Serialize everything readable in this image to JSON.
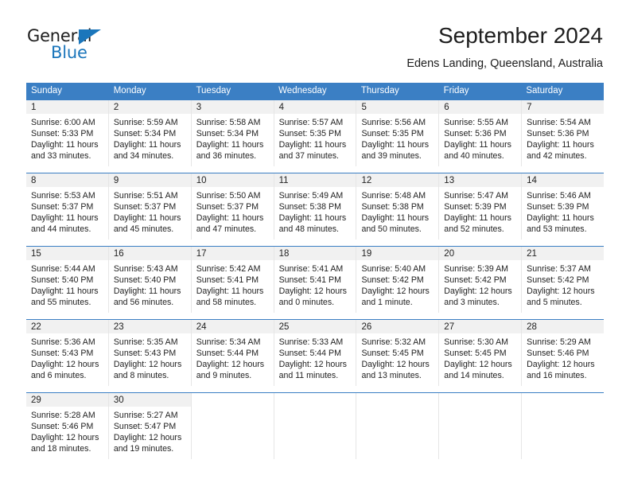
{
  "brand": {
    "name_part1": "General",
    "name_part2": "Blue",
    "triangle_color": "#1b76bb"
  },
  "header": {
    "title": "September 2024",
    "subtitle": "Edens Landing, Queensland, Australia"
  },
  "theme": {
    "header_blue": "#3b7fc4",
    "day_number_band": "#f1f1f1",
    "cell_border": "#e6e6e6",
    "text": "#222222"
  },
  "weekdays": [
    "Sunday",
    "Monday",
    "Tuesday",
    "Wednesday",
    "Thursday",
    "Friday",
    "Saturday"
  ],
  "weeks": [
    [
      {
        "day": "1",
        "sunrise": "Sunrise: 6:00 AM",
        "sunset": "Sunset: 5:33 PM",
        "daylight1": "Daylight: 11 hours",
        "daylight2": "and 33 minutes."
      },
      {
        "day": "2",
        "sunrise": "Sunrise: 5:59 AM",
        "sunset": "Sunset: 5:34 PM",
        "daylight1": "Daylight: 11 hours",
        "daylight2": "and 34 minutes."
      },
      {
        "day": "3",
        "sunrise": "Sunrise: 5:58 AM",
        "sunset": "Sunset: 5:34 PM",
        "daylight1": "Daylight: 11 hours",
        "daylight2": "and 36 minutes."
      },
      {
        "day": "4",
        "sunrise": "Sunrise: 5:57 AM",
        "sunset": "Sunset: 5:35 PM",
        "daylight1": "Daylight: 11 hours",
        "daylight2": "and 37 minutes."
      },
      {
        "day": "5",
        "sunrise": "Sunrise: 5:56 AM",
        "sunset": "Sunset: 5:35 PM",
        "daylight1": "Daylight: 11 hours",
        "daylight2": "and 39 minutes."
      },
      {
        "day": "6",
        "sunrise": "Sunrise: 5:55 AM",
        "sunset": "Sunset: 5:36 PM",
        "daylight1": "Daylight: 11 hours",
        "daylight2": "and 40 minutes."
      },
      {
        "day": "7",
        "sunrise": "Sunrise: 5:54 AM",
        "sunset": "Sunset: 5:36 PM",
        "daylight1": "Daylight: 11 hours",
        "daylight2": "and 42 minutes."
      }
    ],
    [
      {
        "day": "8",
        "sunrise": "Sunrise: 5:53 AM",
        "sunset": "Sunset: 5:37 PM",
        "daylight1": "Daylight: 11 hours",
        "daylight2": "and 44 minutes."
      },
      {
        "day": "9",
        "sunrise": "Sunrise: 5:51 AM",
        "sunset": "Sunset: 5:37 PM",
        "daylight1": "Daylight: 11 hours",
        "daylight2": "and 45 minutes."
      },
      {
        "day": "10",
        "sunrise": "Sunrise: 5:50 AM",
        "sunset": "Sunset: 5:37 PM",
        "daylight1": "Daylight: 11 hours",
        "daylight2": "and 47 minutes."
      },
      {
        "day": "11",
        "sunrise": "Sunrise: 5:49 AM",
        "sunset": "Sunset: 5:38 PM",
        "daylight1": "Daylight: 11 hours",
        "daylight2": "and 48 minutes."
      },
      {
        "day": "12",
        "sunrise": "Sunrise: 5:48 AM",
        "sunset": "Sunset: 5:38 PM",
        "daylight1": "Daylight: 11 hours",
        "daylight2": "and 50 minutes."
      },
      {
        "day": "13",
        "sunrise": "Sunrise: 5:47 AM",
        "sunset": "Sunset: 5:39 PM",
        "daylight1": "Daylight: 11 hours",
        "daylight2": "and 52 minutes."
      },
      {
        "day": "14",
        "sunrise": "Sunrise: 5:46 AM",
        "sunset": "Sunset: 5:39 PM",
        "daylight1": "Daylight: 11 hours",
        "daylight2": "and 53 minutes."
      }
    ],
    [
      {
        "day": "15",
        "sunrise": "Sunrise: 5:44 AM",
        "sunset": "Sunset: 5:40 PM",
        "daylight1": "Daylight: 11 hours",
        "daylight2": "and 55 minutes."
      },
      {
        "day": "16",
        "sunrise": "Sunrise: 5:43 AM",
        "sunset": "Sunset: 5:40 PM",
        "daylight1": "Daylight: 11 hours",
        "daylight2": "and 56 minutes."
      },
      {
        "day": "17",
        "sunrise": "Sunrise: 5:42 AM",
        "sunset": "Sunset: 5:41 PM",
        "daylight1": "Daylight: 11 hours",
        "daylight2": "and 58 minutes."
      },
      {
        "day": "18",
        "sunrise": "Sunrise: 5:41 AM",
        "sunset": "Sunset: 5:41 PM",
        "daylight1": "Daylight: 12 hours",
        "daylight2": "and 0 minutes."
      },
      {
        "day": "19",
        "sunrise": "Sunrise: 5:40 AM",
        "sunset": "Sunset: 5:42 PM",
        "daylight1": "Daylight: 12 hours",
        "daylight2": "and 1 minute."
      },
      {
        "day": "20",
        "sunrise": "Sunrise: 5:39 AM",
        "sunset": "Sunset: 5:42 PM",
        "daylight1": "Daylight: 12 hours",
        "daylight2": "and 3 minutes."
      },
      {
        "day": "21",
        "sunrise": "Sunrise: 5:37 AM",
        "sunset": "Sunset: 5:42 PM",
        "daylight1": "Daylight: 12 hours",
        "daylight2": "and 5 minutes."
      }
    ],
    [
      {
        "day": "22",
        "sunrise": "Sunrise: 5:36 AM",
        "sunset": "Sunset: 5:43 PM",
        "daylight1": "Daylight: 12 hours",
        "daylight2": "and 6 minutes."
      },
      {
        "day": "23",
        "sunrise": "Sunrise: 5:35 AM",
        "sunset": "Sunset: 5:43 PM",
        "daylight1": "Daylight: 12 hours",
        "daylight2": "and 8 minutes."
      },
      {
        "day": "24",
        "sunrise": "Sunrise: 5:34 AM",
        "sunset": "Sunset: 5:44 PM",
        "daylight1": "Daylight: 12 hours",
        "daylight2": "and 9 minutes."
      },
      {
        "day": "25",
        "sunrise": "Sunrise: 5:33 AM",
        "sunset": "Sunset: 5:44 PM",
        "daylight1": "Daylight: 12 hours",
        "daylight2": "and 11 minutes."
      },
      {
        "day": "26",
        "sunrise": "Sunrise: 5:32 AM",
        "sunset": "Sunset: 5:45 PM",
        "daylight1": "Daylight: 12 hours",
        "daylight2": "and 13 minutes."
      },
      {
        "day": "27",
        "sunrise": "Sunrise: 5:30 AM",
        "sunset": "Sunset: 5:45 PM",
        "daylight1": "Daylight: 12 hours",
        "daylight2": "and 14 minutes."
      },
      {
        "day": "28",
        "sunrise": "Sunrise: 5:29 AM",
        "sunset": "Sunset: 5:46 PM",
        "daylight1": "Daylight: 12 hours",
        "daylight2": "and 16 minutes."
      }
    ],
    [
      {
        "day": "29",
        "sunrise": "Sunrise: 5:28 AM",
        "sunset": "Sunset: 5:46 PM",
        "daylight1": "Daylight: 12 hours",
        "daylight2": "and 18 minutes."
      },
      {
        "day": "30",
        "sunrise": "Sunrise: 5:27 AM",
        "sunset": "Sunset: 5:47 PM",
        "daylight1": "Daylight: 12 hours",
        "daylight2": "and 19 minutes."
      },
      {
        "day": "",
        "sunrise": "",
        "sunset": "",
        "daylight1": "",
        "daylight2": ""
      },
      {
        "day": "",
        "sunrise": "",
        "sunset": "",
        "daylight1": "",
        "daylight2": ""
      },
      {
        "day": "",
        "sunrise": "",
        "sunset": "",
        "daylight1": "",
        "daylight2": ""
      },
      {
        "day": "",
        "sunrise": "",
        "sunset": "",
        "daylight1": "",
        "daylight2": ""
      },
      {
        "day": "",
        "sunrise": "",
        "sunset": "",
        "daylight1": "",
        "daylight2": ""
      }
    ]
  ]
}
